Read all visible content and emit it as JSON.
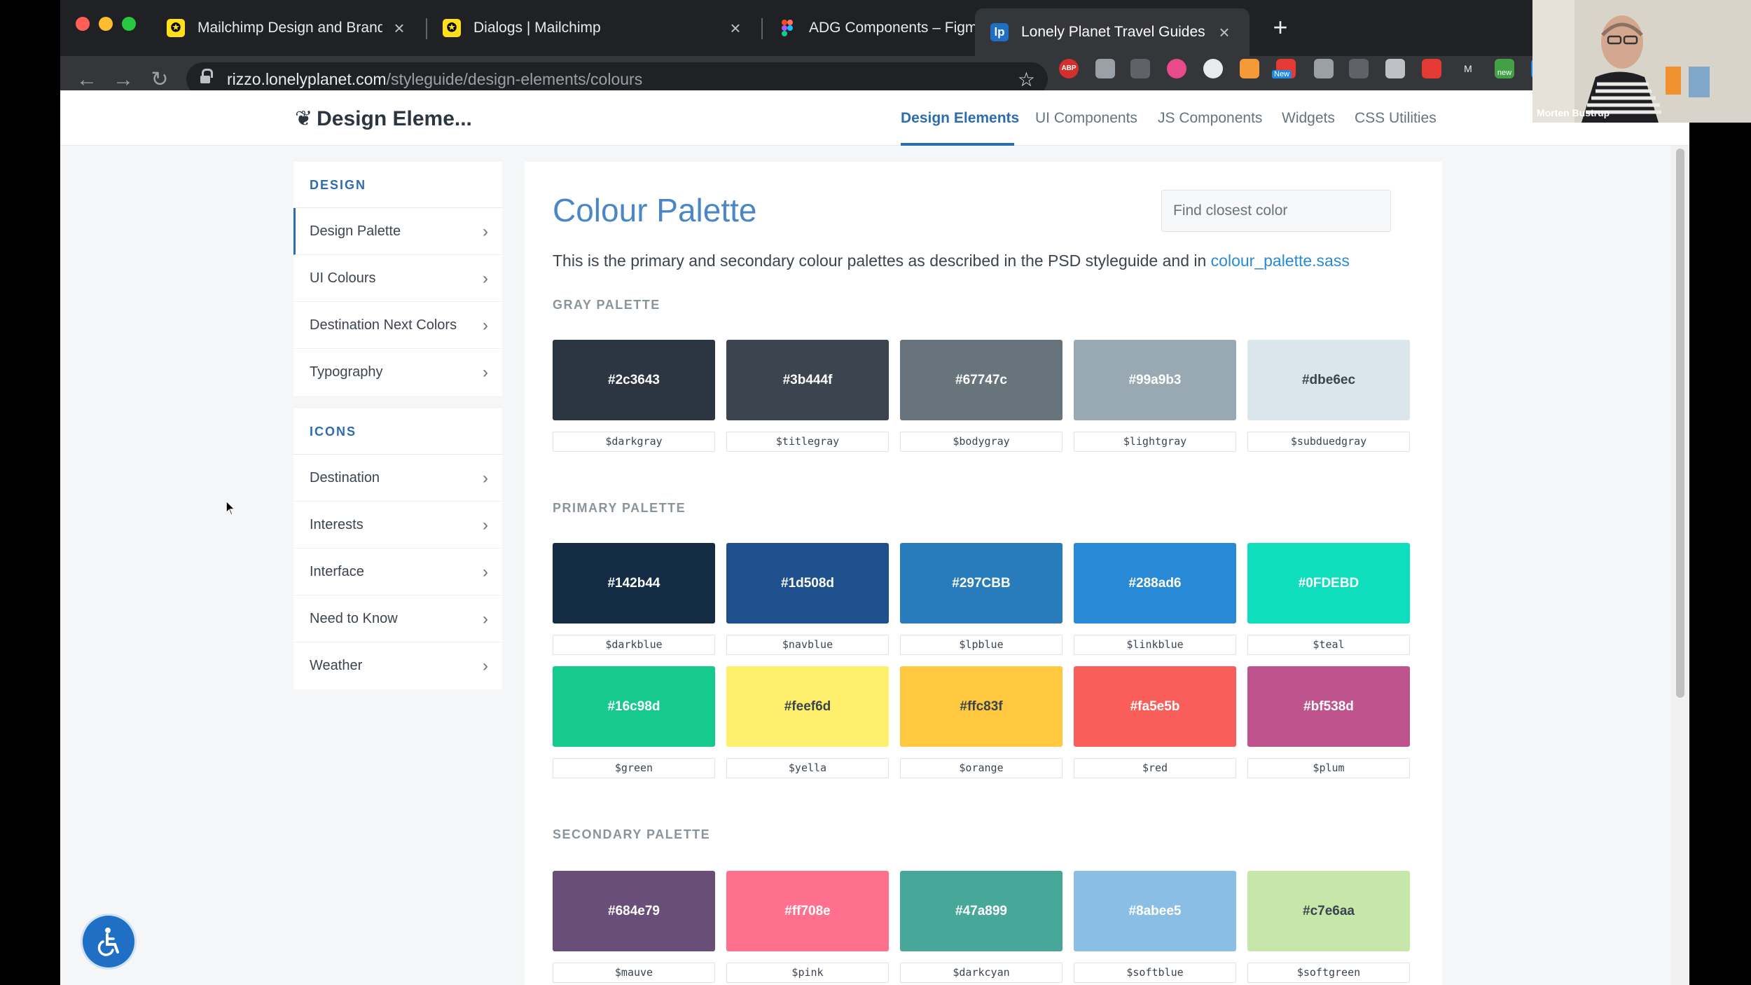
{
  "browser": {
    "tabs": [
      {
        "title": "Mailchimp Design and Brand Id",
        "favicon": "mailchimp-favicon",
        "active": false
      },
      {
        "title": "Dialogs | Mailchimp",
        "favicon": "mailchimp-favicon",
        "active": false
      },
      {
        "title": "ADG Components – Figma",
        "favicon": "figma-favicon",
        "active": false
      },
      {
        "title": "Lonely Planet Travel Guides an",
        "favicon": "lonely-planet-favicon",
        "active": true
      }
    ],
    "new_tab_icon": "+",
    "close_icon": "×",
    "url_host": "rizzo.lonelyplanet.com",
    "url_path": "/styleguide/design-elements/colours",
    "extensions": [
      "ABP",
      "New",
      "new"
    ]
  },
  "site": {
    "title": "Design Eleme...",
    "nav": [
      "Design Elements",
      "UI Components",
      "JS Components",
      "Widgets",
      "CSS Utilities"
    ],
    "active_nav": "Design Elements"
  },
  "sidebar": {
    "design_heading": "DESIGN",
    "design_items": [
      "Design Palette",
      "UI Colours",
      "Destination Next Colors",
      "Typography"
    ],
    "icons_heading": "ICONS",
    "icons_items": [
      "Destination",
      "Interests",
      "Interface",
      "Need to Know",
      "Weather"
    ],
    "chevron": "›"
  },
  "main": {
    "title": "Colour Palette",
    "search_placeholder": "Find closest color",
    "intro_text": "This is the primary and secondary colour palettes as described in the PSD styleguide and in ",
    "intro_link": "colour_palette.sass",
    "palettes": [
      {
        "heading": "GRAY PALETTE",
        "swatches": [
          {
            "hex": "#2c3643",
            "var": "$darkgray",
            "text_color": "#ffffff"
          },
          {
            "hex": "#3b444f",
            "var": "$titlegray",
            "text_color": "#ffffff"
          },
          {
            "hex": "#67747c",
            "var": "$bodygray",
            "text_color": "#ffffff"
          },
          {
            "hex": "#99a9b3",
            "var": "$lightgray",
            "text_color": "#ffffff"
          },
          {
            "hex": "#dbe6ec",
            "var": "$subduedgray",
            "text_color": "#3b444f"
          }
        ]
      },
      {
        "heading": "PRIMARY PALETTE",
        "swatches": [
          {
            "hex": "#142b44",
            "var": "$darkblue",
            "text_color": "#ffffff"
          },
          {
            "hex": "#1d508d",
            "var": "$navblue",
            "text_color": "#ffffff"
          },
          {
            "hex": "#297CBB",
            "var": "$lpblue",
            "text_color": "#ffffff"
          },
          {
            "hex": "#288ad6",
            "var": "$linkblue",
            "text_color": "#ffffff"
          },
          {
            "hex": "#0FDEBD",
            "var": "$teal",
            "text_color": "#ffffff"
          },
          {
            "hex": "#16c98d",
            "var": "$green",
            "text_color": "#ffffff"
          },
          {
            "hex": "#feef6d",
            "var": "$yella",
            "text_color": "#3b444f"
          },
          {
            "hex": "#ffc83f",
            "var": "$orange",
            "text_color": "#3b444f"
          },
          {
            "hex": "#fa5e5b",
            "var": "$red",
            "text_color": "#ffffff"
          },
          {
            "hex": "#bf538d",
            "var": "$plum",
            "text_color": "#ffffff"
          }
        ]
      },
      {
        "heading": "SECONDARY PALETTE",
        "swatches": [
          {
            "hex": "#684e79",
            "var": "$mauve",
            "text_color": "#ffffff"
          },
          {
            "hex": "#ff708e",
            "var": "$pink",
            "text_color": "#ffffff"
          },
          {
            "hex": "#47a899",
            "var": "$darkcyan",
            "text_color": "#ffffff"
          },
          {
            "hex": "#8abee5",
            "var": "$softblue",
            "text_color": "#ffffff"
          },
          {
            "hex": "#c7e6aa",
            "var": "$softgreen",
            "text_color": "#3b444f"
          }
        ]
      }
    ]
  },
  "webcam": {
    "name": "Morten Bustrup"
  }
}
